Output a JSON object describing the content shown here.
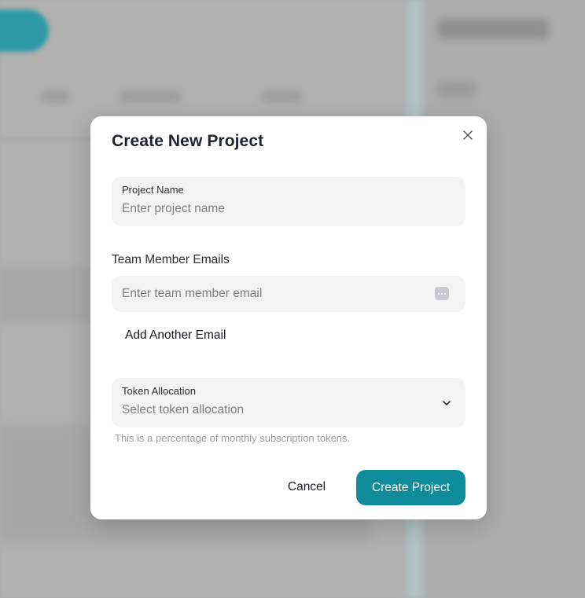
{
  "modal": {
    "title": "Create New Project",
    "project_name": {
      "label": "Project Name",
      "placeholder": "Enter project name"
    },
    "team_emails": {
      "label": "Team Member Emails",
      "placeholder": "Enter team member email",
      "add_label": "Add Another Email"
    },
    "token_allocation": {
      "label": "Token Allocation",
      "placeholder": "Select token allocation",
      "helper": "This is a percentage of monthly subscription tokens."
    },
    "actions": {
      "cancel_label": "Cancel",
      "create_label": "Create Project"
    }
  },
  "icons": {
    "close": "close-icon",
    "email_helper": "password-manager-icon",
    "dropdown": "chevron-down-icon"
  },
  "colors": {
    "accent": "#0e8c9c",
    "field_bg": "#f3f3f5",
    "overlay": "#ababab"
  }
}
